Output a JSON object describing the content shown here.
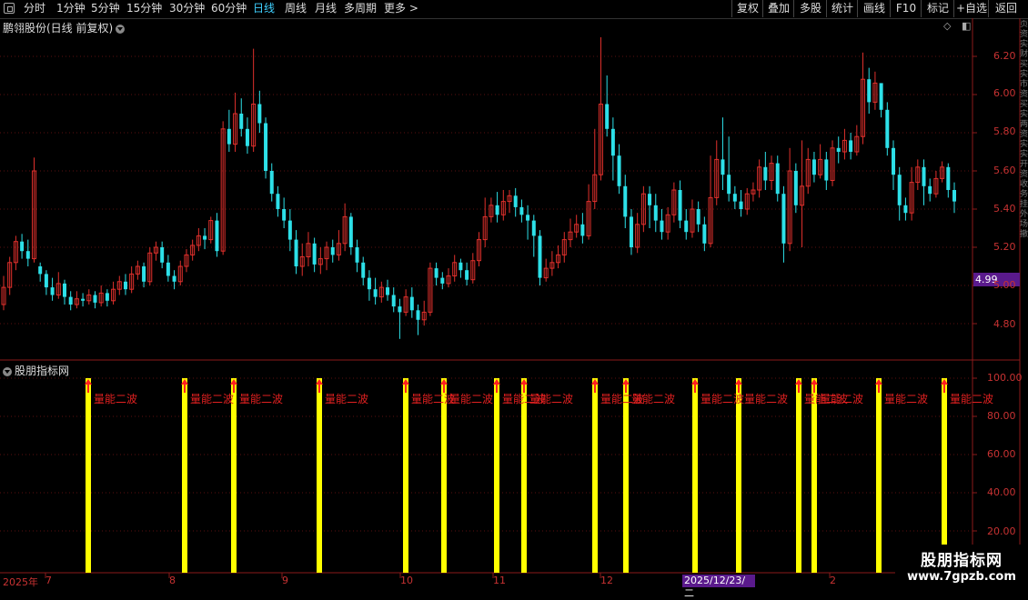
{
  "toolbar": {
    "tabs": [
      "分时",
      "1分钟",
      "5分钟",
      "15分钟",
      "30分钟",
      "60分钟",
      "日线",
      "周线",
      "月线",
      "多周期",
      "更多 >"
    ],
    "active_tab": "日线",
    "right_buttons": [
      "复权",
      "叠加",
      "多股",
      "统计",
      "画线",
      "F10",
      "标记",
      "+自选",
      "返回"
    ]
  },
  "main_chart": {
    "title": "鹏翎股份(日线 前复权)",
    "y_ticks": [
      "6.20",
      "6.00",
      "5.80",
      "5.60",
      "5.40",
      "5.20",
      "5.00",
      "4.80"
    ],
    "current_price": "4.99"
  },
  "indicator": {
    "title": "股朋指标网",
    "y_ticks": [
      "100.00",
      "80.00",
      "60.00",
      "40.00",
      "20.00"
    ],
    "signal_label": "量能二波",
    "signal_value": 100
  },
  "x_axis": {
    "labels": [
      "2025年",
      "7",
      "8",
      "9",
      "10",
      "11",
      "12",
      "2025/12/23/二",
      "2"
    ],
    "cursor_date": "2025/12/23/二"
  },
  "watermark": {
    "title": "股朋指标网",
    "url": "www.7gpzb.com"
  },
  "right_strip_text": "页资实财买实市资买实两资实实开资收务挂外场撤",
  "colors": {
    "up": "#e0302c",
    "down": "#2de0e8",
    "signal": "#ffff00",
    "label": "#e02020",
    "accent": "#3fd0ff",
    "tag": "#5a1a8c"
  },
  "chart_data": {
    "type": "candlestick",
    "series_name": "鹏翎股份",
    "period": "日线",
    "adjust": "前复权",
    "ylim": [
      4.68,
      6.32
    ],
    "candles": [
      [
        4.9,
        4.99,
        4.87,
        5.05
      ],
      [
        4.99,
        5.12,
        4.95,
        5.15
      ],
      [
        5.12,
        5.23,
        5.08,
        5.26
      ],
      [
        5.23,
        5.18,
        5.14,
        5.27
      ],
      [
        5.18,
        5.14,
        5.1,
        5.24
      ],
      [
        5.14,
        5.6,
        5.12,
        5.67
      ],
      [
        5.1,
        5.06,
        5.02,
        5.12
      ],
      [
        5.06,
        4.99,
        4.95,
        5.08
      ],
      [
        4.99,
        4.95,
        4.92,
        5.04
      ],
      [
        4.95,
        5.01,
        4.93,
        5.07
      ],
      [
        5.01,
        4.94,
        4.9,
        5.03
      ],
      [
        4.94,
        4.9,
        4.87,
        4.97
      ],
      [
        4.9,
        4.93,
        4.88,
        4.97
      ],
      [
        4.93,
        4.92,
        4.89,
        4.96
      ],
      [
        4.92,
        4.95,
        4.9,
        4.98
      ],
      [
        4.95,
        4.91,
        4.88,
        4.97
      ],
      [
        4.91,
        4.96,
        4.89,
        5.0
      ],
      [
        4.96,
        4.92,
        4.89,
        4.98
      ],
      [
        4.92,
        4.98,
        4.9,
        5.02
      ],
      [
        4.98,
        5.02,
        4.95,
        5.05
      ],
      [
        5.02,
        4.98,
        4.95,
        5.06
      ],
      [
        4.98,
        5.06,
        4.96,
        5.1
      ],
      [
        5.06,
        5.1,
        5.03,
        5.13
      ],
      [
        5.1,
        5.02,
        4.99,
        5.12
      ],
      [
        5.02,
        5.17,
        5.0,
        5.2
      ],
      [
        5.17,
        5.2,
        5.13,
        5.23
      ],
      [
        5.2,
        5.12,
        5.09,
        5.23
      ],
      [
        5.12,
        5.05,
        5.02,
        5.16
      ],
      [
        5.05,
        5.02,
        4.98,
        5.08
      ],
      [
        5.02,
        5.1,
        5.0,
        5.13
      ],
      [
        5.1,
        5.16,
        5.07,
        5.19
      ],
      [
        5.16,
        5.21,
        5.13,
        5.24
      ],
      [
        5.21,
        5.26,
        5.18,
        5.3
      ],
      [
        5.26,
        5.24,
        5.19,
        5.3
      ],
      [
        5.24,
        5.34,
        5.22,
        5.36
      ],
      [
        5.34,
        5.18,
        5.15,
        5.38
      ],
      [
        5.18,
        5.82,
        5.16,
        5.86
      ],
      [
        5.82,
        5.74,
        5.7,
        5.92
      ],
      [
        5.74,
        5.9,
        5.7,
        6.01
      ],
      [
        5.9,
        5.82,
        5.78,
        5.98
      ],
      [
        5.82,
        5.73,
        5.69,
        5.88
      ],
      [
        5.73,
        5.95,
        5.7,
        6.24
      ],
      [
        5.95,
        5.85,
        5.8,
        6.02
      ],
      [
        5.85,
        5.6,
        5.56,
        5.88
      ],
      [
        5.6,
        5.48,
        5.44,
        5.64
      ],
      [
        5.48,
        5.4,
        5.36,
        5.52
      ],
      [
        5.4,
        5.34,
        5.3,
        5.46
      ],
      [
        5.34,
        5.24,
        5.18,
        5.4
      ],
      [
        5.24,
        5.1,
        5.06,
        5.29
      ],
      [
        5.1,
        5.15,
        5.05,
        5.22
      ],
      [
        5.15,
        5.22,
        5.1,
        5.28
      ],
      [
        5.22,
        5.11,
        5.07,
        5.25
      ],
      [
        5.11,
        5.14,
        5.06,
        5.2
      ],
      [
        5.14,
        5.2,
        5.08,
        5.23
      ],
      [
        5.2,
        5.16,
        5.12,
        5.24
      ],
      [
        5.16,
        5.22,
        5.13,
        5.29
      ],
      [
        5.22,
        5.36,
        5.18,
        5.43
      ],
      [
        5.36,
        5.2,
        5.16,
        5.38
      ],
      [
        5.2,
        5.12,
        5.07,
        5.24
      ],
      [
        5.12,
        5.04,
        5.0,
        5.15
      ],
      [
        5.04,
        4.98,
        4.92,
        5.08
      ],
      [
        4.98,
        4.94,
        4.9,
        5.04
      ],
      [
        4.94,
        4.99,
        4.91,
        5.02
      ],
      [
        4.99,
        4.95,
        4.92,
        5.03
      ],
      [
        4.95,
        4.89,
        4.86,
        4.99
      ],
      [
        4.89,
        4.86,
        4.72,
        4.93
      ],
      [
        4.86,
        4.94,
        4.84,
        4.98
      ],
      [
        4.94,
        4.87,
        4.83,
        4.99
      ],
      [
        4.87,
        4.82,
        4.74,
        4.9
      ],
      [
        4.82,
        4.86,
        4.79,
        4.92
      ],
      [
        4.86,
        5.09,
        4.84,
        5.12
      ],
      [
        5.09,
        5.04,
        5.0,
        5.12
      ],
      [
        5.04,
        5.01,
        4.98,
        5.07
      ],
      [
        5.01,
        5.05,
        4.99,
        5.09
      ],
      [
        5.05,
        5.12,
        5.02,
        5.16
      ],
      [
        5.12,
        5.08,
        5.04,
        5.14
      ],
      [
        5.08,
        5.03,
        5.0,
        5.12
      ],
      [
        5.03,
        5.13,
        5.01,
        5.17
      ],
      [
        5.13,
        5.24,
        5.1,
        5.28
      ],
      [
        5.24,
        5.36,
        5.2,
        5.46
      ],
      [
        5.36,
        5.42,
        5.33,
        5.46
      ],
      [
        5.42,
        5.37,
        5.33,
        5.49
      ],
      [
        5.37,
        5.44,
        5.34,
        5.5
      ],
      [
        5.44,
        5.47,
        5.38,
        5.5
      ],
      [
        5.47,
        5.41,
        5.36,
        5.51
      ],
      [
        5.41,
        5.37,
        5.33,
        5.45
      ],
      [
        5.37,
        5.34,
        5.24,
        5.42
      ],
      [
        5.34,
        5.26,
        5.15,
        5.37
      ],
      [
        5.26,
        5.04,
        5.0,
        5.29
      ],
      [
        5.04,
        5.09,
        5.02,
        5.14
      ],
      [
        5.09,
        5.12,
        5.05,
        5.18
      ],
      [
        5.12,
        5.16,
        5.09,
        5.21
      ],
      [
        5.16,
        5.24,
        5.12,
        5.28
      ],
      [
        5.24,
        5.28,
        5.2,
        5.35
      ],
      [
        5.28,
        5.32,
        5.25,
        5.37
      ],
      [
        5.32,
        5.26,
        5.22,
        5.38
      ],
      [
        5.26,
        5.44,
        5.24,
        5.53
      ],
      [
        5.44,
        5.58,
        5.4,
        5.82
      ],
      [
        5.58,
        5.95,
        5.55,
        6.3
      ],
      [
        5.95,
        5.82,
        5.78,
        6.1
      ],
      [
        5.82,
        5.68,
        5.55,
        5.88
      ],
      [
        5.68,
        5.52,
        5.48,
        5.74
      ],
      [
        5.52,
        5.36,
        5.3,
        5.58
      ],
      [
        5.36,
        5.2,
        5.16,
        5.4
      ],
      [
        5.2,
        5.32,
        5.17,
        5.38
      ],
      [
        5.32,
        5.48,
        5.28,
        5.52
      ],
      [
        5.48,
        5.42,
        5.3,
        5.52
      ],
      [
        5.42,
        5.34,
        5.28,
        5.48
      ],
      [
        5.34,
        5.28,
        5.24,
        5.4
      ],
      [
        5.28,
        5.37,
        5.24,
        5.41
      ],
      [
        5.37,
        5.5,
        5.33,
        5.54
      ],
      [
        5.5,
        5.34,
        5.3,
        5.55
      ],
      [
        5.34,
        5.28,
        5.24,
        5.4
      ],
      [
        5.28,
        5.4,
        5.25,
        5.45
      ],
      [
        5.4,
        5.32,
        5.28,
        5.44
      ],
      [
        5.32,
        5.22,
        5.18,
        5.36
      ],
      [
        5.22,
        5.46,
        5.2,
        5.68
      ],
      [
        5.46,
        5.66,
        5.42,
        5.76
      ],
      [
        5.66,
        5.58,
        5.5,
        5.88
      ],
      [
        5.58,
        5.48,
        5.44,
        5.78
      ],
      [
        5.48,
        5.44,
        5.4,
        5.52
      ],
      [
        5.44,
        5.4,
        5.36,
        5.5
      ],
      [
        5.4,
        5.48,
        5.37,
        5.51
      ],
      [
        5.48,
        5.5,
        5.44,
        5.54
      ],
      [
        5.5,
        5.62,
        5.46,
        5.66
      ],
      [
        5.62,
        5.55,
        5.5,
        5.7
      ],
      [
        5.55,
        5.64,
        5.5,
        5.68
      ],
      [
        5.64,
        5.48,
        5.44,
        5.68
      ],
      [
        5.48,
        5.22,
        5.12,
        5.52
      ],
      [
        5.22,
        5.6,
        5.18,
        5.72
      ],
      [
        5.6,
        5.42,
        5.38,
        5.64
      ],
      [
        5.42,
        5.52,
        5.2,
        5.76
      ],
      [
        5.52,
        5.66,
        5.48,
        5.72
      ],
      [
        5.66,
        5.58,
        5.54,
        5.7
      ],
      [
        5.58,
        5.66,
        5.56,
        5.74
      ],
      [
        5.66,
        5.55,
        5.5,
        5.7
      ],
      [
        5.55,
        5.72,
        5.52,
        5.76
      ],
      [
        5.72,
        5.7,
        5.64,
        5.78
      ],
      [
        5.7,
        5.76,
        5.66,
        5.82
      ],
      [
        5.76,
        5.7,
        5.66,
        5.8
      ],
      [
        5.7,
        5.78,
        5.68,
        5.84
      ],
      [
        5.78,
        6.08,
        5.74,
        6.22
      ],
      [
        6.08,
        5.96,
        5.9,
        6.14
      ],
      [
        5.96,
        6.06,
        5.92,
        6.12
      ],
      [
        6.06,
        5.92,
        5.88,
        6.0
      ],
      [
        5.92,
        5.72,
        5.68,
        5.96
      ],
      [
        5.72,
        5.58,
        5.5,
        5.76
      ],
      [
        5.58,
        5.42,
        5.34,
        5.62
      ],
      [
        5.42,
        5.38,
        5.34,
        5.46
      ],
      [
        5.38,
        5.54,
        5.34,
        5.62
      ],
      [
        5.54,
        5.62,
        5.5,
        5.66
      ],
      [
        5.62,
        5.52,
        5.42,
        5.66
      ],
      [
        5.52,
        5.48,
        5.44,
        5.56
      ],
      [
        5.48,
        5.56,
        5.46,
        5.6
      ],
      [
        5.56,
        5.62,
        5.54,
        5.65
      ],
      [
        5.62,
        5.5,
        5.46,
        5.64
      ],
      [
        5.5,
        5.44,
        5.38,
        5.54
      ]
    ],
    "signals": {
      "name": "量能二波",
      "value": 100
    }
  }
}
